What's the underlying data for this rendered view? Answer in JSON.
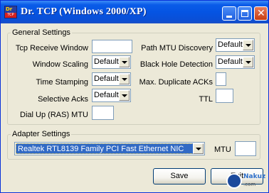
{
  "window": {
    "title": "Dr. TCP (Windows 2000/XP)",
    "icon_text_top": "Dr",
    "icon_text_bottom": "TCP"
  },
  "general": {
    "legend": "General Settings",
    "tcp_receive_window": {
      "label": "Tcp Receive Window",
      "value": ""
    },
    "window_scaling": {
      "label": "Window Scaling",
      "value": "Default"
    },
    "time_stamping": {
      "label": "Time Stamping",
      "value": "Default"
    },
    "selective_acks": {
      "label": "Selective Acks",
      "value": "Default"
    },
    "dialup_mtu": {
      "label": "Dial Up (RAS) MTU",
      "value": ""
    },
    "path_mtu_discovery": {
      "label": "Path MTU Discovery",
      "value": "Default"
    },
    "black_hole_detection": {
      "label": "Black Hole Detection",
      "value": "Default"
    },
    "max_duplicate_acks": {
      "label": "Max. Duplicate ACKs",
      "value": ""
    },
    "ttl": {
      "label": "TTL",
      "value": ""
    }
  },
  "adapter": {
    "legend": "Adapter Settings",
    "selected": "Realtek RTL8139 Family PCI Fast Ethernet NIC",
    "mtu_label": "MTU",
    "mtu_value": ""
  },
  "buttons": {
    "save": "Save",
    "exit": "Exit"
  },
  "watermark": {
    "text": "Nakuz",
    "subtext": ".com"
  }
}
